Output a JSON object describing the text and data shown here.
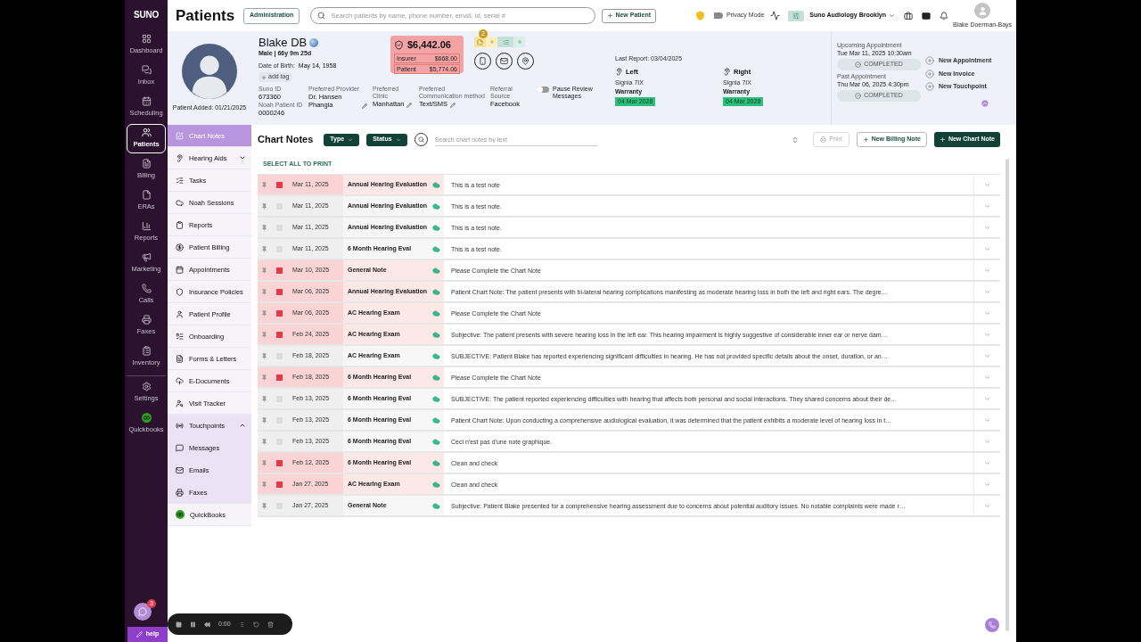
{
  "app": {
    "logo": "SUNO"
  },
  "nav": [
    {
      "label": "Dashboard",
      "selected": false
    },
    {
      "label": "Inbox",
      "selected": false
    },
    {
      "label": "Scheduling",
      "selected": false
    },
    {
      "label": "Patients",
      "selected": true
    },
    {
      "label": "Billing",
      "selected": false
    },
    {
      "label": "ERAs",
      "selected": false
    },
    {
      "label": "Reports",
      "selected": false
    },
    {
      "label": "Marketing",
      "selected": false
    },
    {
      "label": "Calls",
      "selected": false
    },
    {
      "label": "Faxes",
      "selected": false
    },
    {
      "label": "Inventory",
      "selected": false
    },
    {
      "label": "Settings",
      "selected": false
    },
    {
      "label": "Quickbooks",
      "selected": false
    }
  ],
  "topbar": {
    "title": "Patients",
    "filter_on": true,
    "admin_button": "Administration",
    "search_placeholder": "Search patients by name, phone number, email, id, serial #",
    "new_patient": "New Patient",
    "privacy_mode": {
      "label": "Privacy Mode",
      "on": false
    },
    "location": "Suno Audiology Brooklyn",
    "user": "Blake Doerman-Bays"
  },
  "patient": {
    "name": "Blake DB",
    "sex_age": "Male | 66y 9m 25d",
    "dob_label": "Date of Birth:",
    "dob": "May 14, 1958",
    "add_tag": "add tag",
    "added": "Patient Added: 01/21/2025",
    "balance": "$6,442.06",
    "insurer_label": "Insurer",
    "insurer": "$668.00",
    "patient_label": "Patient",
    "patient_amount": "$5,774.06",
    "notes_badge": "2",
    "fields": [
      {
        "label": "Suno ID",
        "value": "673360",
        "editable": false
      },
      {
        "label": "Noah Patient ID",
        "value": "0000246",
        "editable": false
      },
      {
        "label": "Preferred Provider",
        "value": "Dr. Hansen Phangia",
        "editable": true
      },
      {
        "label": "Preferred Clinic",
        "value": "Manhattan",
        "editable": true
      },
      {
        "label": "Preferred Communication method",
        "value": "Text/SMS",
        "editable": true
      },
      {
        "label": "Referral Source",
        "value": "Facebook",
        "editable": false
      }
    ],
    "pause_review": {
      "label": "Pause Review Messages",
      "on": false
    }
  },
  "hearing": {
    "last_report": "Last Report: 03/04/2025",
    "aids": [
      {
        "side": "Left",
        "model": "Signia 7IX",
        "warranty_label": "Warranty",
        "warranty": "04 Mar 2028"
      },
      {
        "side": "Right",
        "model": "Signia 7IX",
        "warranty_label": "Warranty",
        "warranty": "04 Mar 2028"
      }
    ]
  },
  "appointments": [
    {
      "label": "Upcoming Appointment",
      "when": "Tue Mar 11, 2025 10:30am",
      "status": "COMPLETED"
    },
    {
      "label": "Past Appointment",
      "when": "Thu Mar 06, 2025 4:30pm",
      "status": "COMPLETED"
    }
  ],
  "quick_actions": [
    "New Appointment",
    "New Invoice",
    "New Touchpoint"
  ],
  "subnav": [
    {
      "label": "Chart Notes",
      "kind": "item",
      "selected": true
    },
    {
      "label": "Hearing Aids",
      "kind": "group",
      "selected": false,
      "expanded": false
    },
    {
      "label": "Tasks",
      "kind": "item",
      "selected": false
    },
    {
      "label": "Noah Sessions",
      "kind": "item",
      "selected": false
    },
    {
      "label": "Reports",
      "kind": "item",
      "selected": false
    },
    {
      "label": "Patient Billing",
      "kind": "item",
      "selected": false
    },
    {
      "label": "Appointments",
      "kind": "item",
      "selected": false
    },
    {
      "label": "Insurance Policies",
      "kind": "item",
      "selected": false
    },
    {
      "label": "Patient Profile",
      "kind": "item",
      "selected": false
    },
    {
      "label": "Onboarding",
      "kind": "item",
      "selected": false
    },
    {
      "label": "Forms & Letters",
      "kind": "item",
      "selected": false
    },
    {
      "label": "E-Documents",
      "kind": "item",
      "selected": false
    },
    {
      "label": "Visit Tracker",
      "kind": "item",
      "selected": false
    },
    {
      "label": "Touchpoints",
      "kind": "group",
      "selected": false,
      "expanded": true,
      "children": [
        {
          "label": "Messages",
          "selected": false
        },
        {
          "label": "Emails",
          "selected": false
        },
        {
          "label": "Faxes",
          "selected": false
        }
      ]
    },
    {
      "label": "QuickBooks",
      "kind": "item",
      "selected": false
    }
  ],
  "chart_notes": {
    "title": "Chart Notes",
    "filters": [
      "Type",
      "Status"
    ],
    "search_placeholder": "Search chart notes by text",
    "print": {
      "label": "Print",
      "disabled": true
    },
    "new_billing": "New Billing Note",
    "new_chart": "New Chart Note",
    "select_all": "SELECT ALL TO PRINT",
    "rows": [
      {
        "date": "Mar 11, 2025",
        "type": "Annual Hearing Evaluation",
        "note": "This is a test note",
        "flagged": true
      },
      {
        "date": "Mar 11, 2025",
        "type": "Annual Hearing Evaluation",
        "note": "This is a test note.",
        "flagged": false
      },
      {
        "date": "Mar 11, 2025",
        "type": "Annual Hearing Evaluation",
        "note": "This is a test note.",
        "flagged": false
      },
      {
        "date": "Mar 11, 2025",
        "type": "6 Month Hearing Eval",
        "note": "This is a test note.",
        "flagged": false
      },
      {
        "date": "Mar 10, 2025",
        "type": "General Note",
        "note": "Please Complete the Chart Note",
        "flagged": true
      },
      {
        "date": "Mar 06, 2025",
        "type": "Annual Hearing Evaluation",
        "note": "Patient Chart Note: The patient presents with bi-lateral hearing complications manifesting as moderate hearing loss in both the left and right ears. The degre…",
        "flagged": true
      },
      {
        "date": "Mar 06, 2025",
        "type": "AC Hearing Exam",
        "note": "Please Complete the Chart Note",
        "flagged": true
      },
      {
        "date": "Feb 24, 2025",
        "type": "AC Hearing Exam",
        "note": "Subjective: The patient presents with severe hearing loss in the left ear. This hearing impairment is highly suggestive of considerable inner ear or nerve dam…",
        "flagged": true
      },
      {
        "date": "Feb 18, 2025",
        "type": "AC Hearing Exam",
        "note": "SUBJECTIVE: Patient Blake has reported experiencing significant difficulties in hearing. He has not provided specific details about the onset, duration, or an…",
        "flagged": false
      },
      {
        "date": "Feb 18, 2025",
        "type": "6 Month Hearing Eval",
        "note": "Please Complete the Chart Note",
        "flagged": true
      },
      {
        "date": "Feb 13, 2025",
        "type": "6 Month Hearing Eval",
        "note": "SUBJECTIVE: The patient reported experiencing difficulties with hearing that affects both personal and social interactions. They shared concerns about their de…",
        "flagged": false
      },
      {
        "date": "Feb 13, 2025",
        "type": "6 Month Hearing Eval",
        "note": "Patient Chart Note: Upon conducting a comprehensive audiological evaluation, it was determined that the patient exhibits a moderate level of hearing loss in t…",
        "flagged": false
      },
      {
        "date": "Feb 13, 2025",
        "type": "6 Month Hearing Eval",
        "note": "Ceci n'est pas d'une note graphique.",
        "flagged": false
      },
      {
        "date": "Feb 12, 2025",
        "type": "6 Month Hearing Eval",
        "note": "Clean and check",
        "flagged": true
      },
      {
        "date": "Jan 27, 2025",
        "type": "AC Hearing Exam",
        "note": "Clean and check",
        "flagged": true
      },
      {
        "date": "Jan 27, 2025",
        "type": "General Note",
        "note": "Subjective:  Patient Blake presented for a comprehensive hearing assessment due to concerns about potential auditory issues. No notable complaints were made r…",
        "flagged": false
      }
    ]
  },
  "footer": {
    "chat_badge": "3",
    "timer": "0:00",
    "help": "help"
  }
}
